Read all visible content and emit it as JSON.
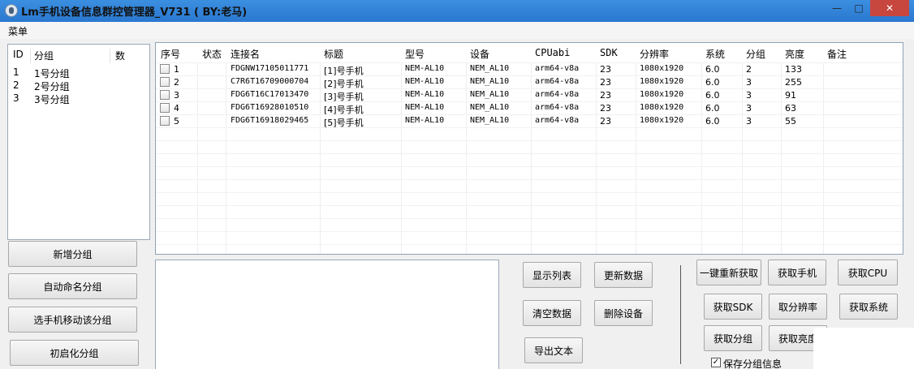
{
  "window": {
    "title": "Lm手机设备信息群控管理器_V731 ( BY:老马)",
    "minimize": "—",
    "maximize": "□",
    "close": "✕"
  },
  "menu": {
    "label": "菜单"
  },
  "groups": {
    "headers": [
      "ID",
      "分组",
      "数"
    ],
    "rows": [
      {
        "id": "1",
        "name": "1号分组"
      },
      {
        "id": "2",
        "name": "2号分组"
      },
      {
        "id": "3",
        "name": "3号分组"
      }
    ]
  },
  "group_buttons": {
    "add": "新增分组",
    "auto_name": "自动命名分组",
    "move": "选手机移动该分组",
    "init": "初启化分组"
  },
  "devices": {
    "headers": [
      "序号",
      "状态",
      "连接名",
      "标题",
      "型号",
      "设备",
      "CPUabi",
      "SDK",
      "分辨率",
      "系统",
      "分组",
      "亮度",
      "备注"
    ],
    "rows": [
      {
        "no": "1",
        "conn": "FDGNW17105011771",
        "title": "[1]号手机",
        "model": "NEM-AL10",
        "device": "NEM_AL10",
        "cpu": "arm64-v8a",
        "sdk": "23",
        "res": "1080x1920",
        "sys": "6.0",
        "group": "2",
        "bright": "133"
      },
      {
        "no": "2",
        "conn": "C7R6T16709000704",
        "title": "[2]号手机",
        "model": "NEM-AL10",
        "device": "NEM_AL10",
        "cpu": "arm64-v8a",
        "sdk": "23",
        "res": "1080x1920",
        "sys": "6.0",
        "group": "3",
        "bright": "255"
      },
      {
        "no": "3",
        "conn": "FDG6T16C17013470",
        "title": "[3]号手机",
        "model": "NEM-AL10",
        "device": "NEM_AL10",
        "cpu": "arm64-v8a",
        "sdk": "23",
        "res": "1080x1920",
        "sys": "6.0",
        "group": "3",
        "bright": "91"
      },
      {
        "no": "4",
        "conn": "FDG6T16928010510",
        "title": "[4]号手机",
        "model": "NEM-AL10",
        "device": "NEM_AL10",
        "cpu": "arm64-v8a",
        "sdk": "23",
        "res": "1080x1920",
        "sys": "6.0",
        "group": "3",
        "bright": "63"
      },
      {
        "no": "5",
        "conn": "FDG6T16918029465",
        "title": "[5]号手机",
        "model": "NEM-AL10",
        "device": "NEM_AL10",
        "cpu": "arm64-v8a",
        "sdk": "23",
        "res": "1080x1920",
        "sys": "6.0",
        "group": "3",
        "bright": "55"
      }
    ]
  },
  "actions": {
    "show_list": "显示列表",
    "update_data": "更新数据",
    "clear_data": "清空数据",
    "delete_device": "删除设备",
    "export_text": "导出文本",
    "refetch_all": "一键重新获取",
    "get_phone": "获取手机",
    "get_cpu": "获取CPU",
    "get_sdk": "获取SDK",
    "get_resolution": "取分辨率",
    "get_system": "获取系统",
    "get_group": "获取分组",
    "get_brightness": "获取亮度"
  },
  "save_group": {
    "label": "保存分组信息",
    "checked": "✓"
  }
}
